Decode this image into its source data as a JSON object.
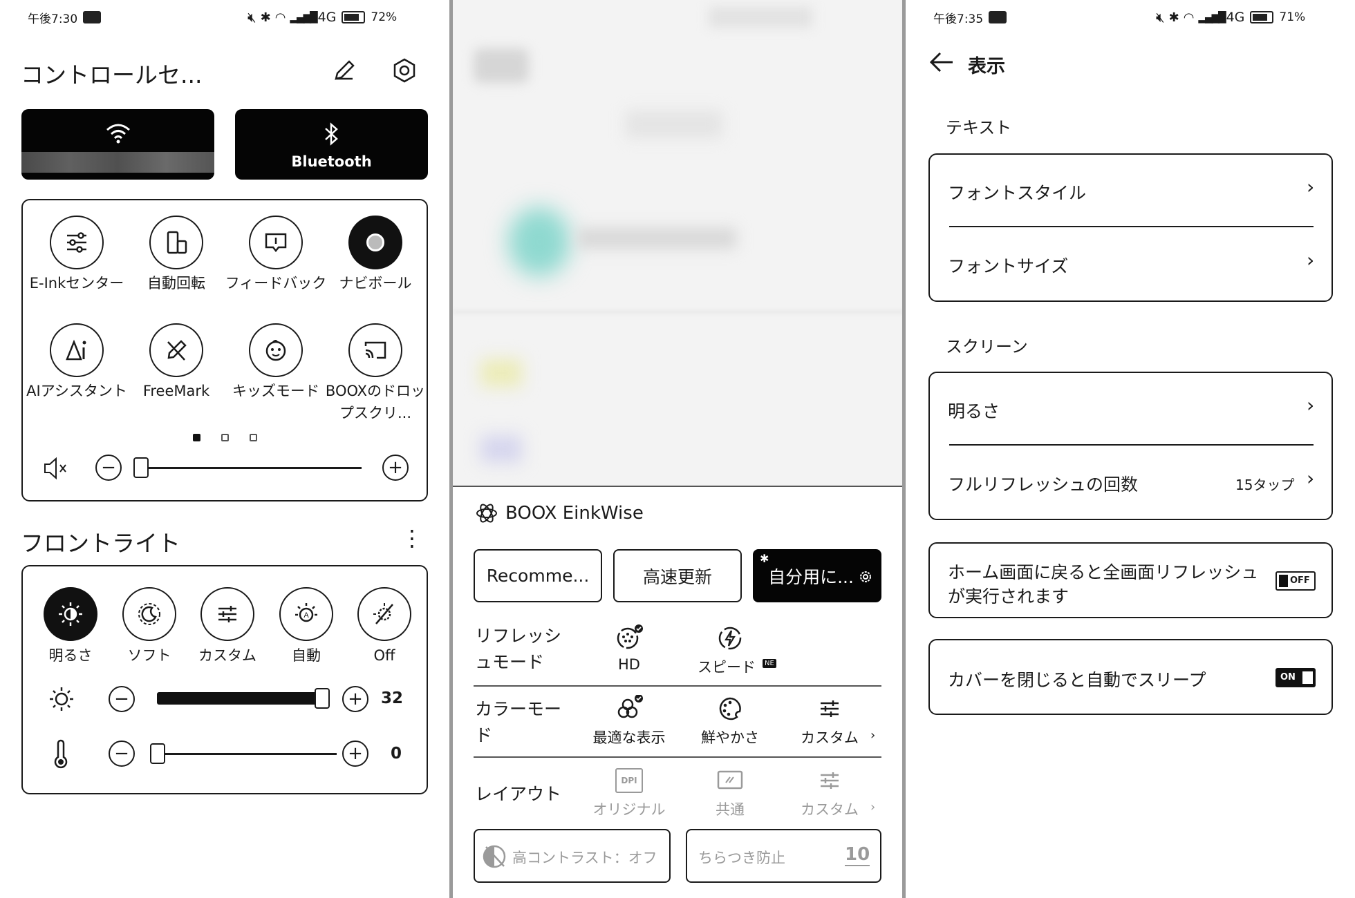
{
  "panel1": {
    "status": {
      "time": "午後7:30",
      "network": "4G",
      "battery": "72%"
    },
    "title": "コントロールセ...",
    "bluetooth_label": "Bluetooth",
    "tiles": [
      {
        "label": "E-Inkセンター",
        "icon": "sliders-icon"
      },
      {
        "label": "自動回転",
        "icon": "rotate-icon"
      },
      {
        "label": "フィードバック",
        "icon": "feedback-icon"
      },
      {
        "label": "ナビボール",
        "icon": "navball-icon"
      },
      {
        "label": "AIアシスタント",
        "icon": "ai-icon"
      },
      {
        "label": "FreeMark",
        "icon": "pen-icon"
      },
      {
        "label": "キッズモード",
        "icon": "kids-icon"
      },
      {
        "label": "BOOXのドロップスクリ...",
        "icon": "cast-icon"
      }
    ],
    "volume_level": 0.0,
    "frontlight_title": "フロントライト",
    "light_modes": [
      {
        "label": "明るさ",
        "selected": true
      },
      {
        "label": "ソフト",
        "selected": false
      },
      {
        "label": "カスタム",
        "selected": false
      },
      {
        "label": "自動",
        "selected": false
      },
      {
        "label": "Off",
        "selected": false
      }
    ],
    "brightness_value": "32",
    "brightness_level": 1.0,
    "warmth_value": "0",
    "warmth_level": 0.0
  },
  "panel2": {
    "title": "BOOX EinkWise",
    "modes": [
      "Recomme...",
      "高速更新",
      "自分用に..."
    ],
    "refresh_label": "リフレッシュモード",
    "refresh_options": [
      "HD",
      "スピード"
    ],
    "new_badge": "NE",
    "color_label": "カラーモード",
    "color_options": [
      "最適な表示",
      "鮮やかさ",
      "カスタム"
    ],
    "layout_label": "レイアウト",
    "layout_options": [
      "オリジナル",
      "共通",
      "カスタム"
    ],
    "dpi": "DPI",
    "high_contrast": "高コントラスト：オフ",
    "anti_flicker": "ちらつき防止",
    "anti_flicker_value": "10"
  },
  "panel3": {
    "status": {
      "time": "午後7:35",
      "network": "4G",
      "battery": "71%"
    },
    "title": "表示",
    "section_text": "テキスト",
    "font_style": "フォントスタイル",
    "font_size": "フォントサイズ",
    "section_screen": "スクリーン",
    "brightness": "明るさ",
    "full_refresh": "フルリフレッシュの回数",
    "full_refresh_value": "15タップ",
    "home_refresh_line1": "ホーム画面に戻ると全画面リフレッシュ",
    "home_refresh_line2": "が実行されます",
    "home_refresh_toggle": "OFF",
    "cover_sleep": "カバーを閉じると自動でスリープ",
    "cover_sleep_toggle": "ON"
  }
}
